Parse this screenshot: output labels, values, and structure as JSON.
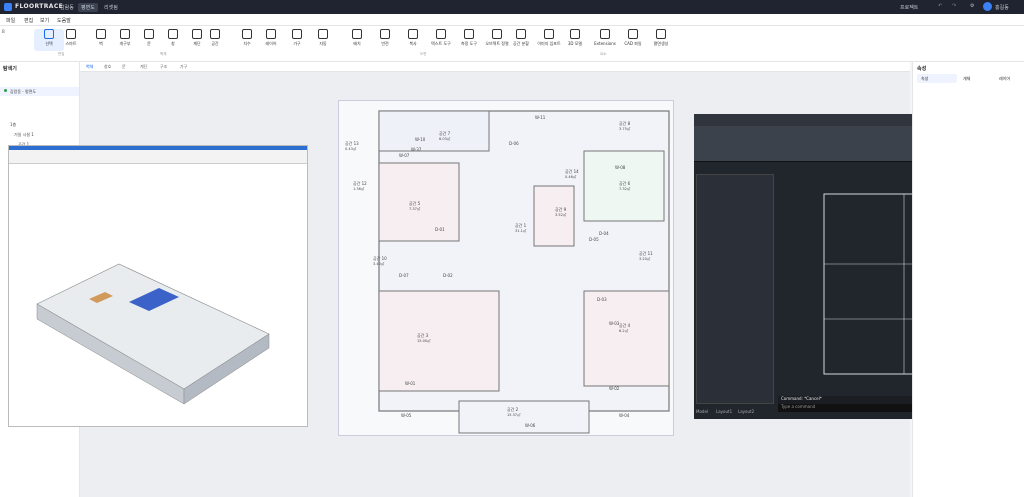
{
  "app": {
    "brand": "FLOORTRACE",
    "project": "감람동",
    "tab": "평면도",
    "file_tag": "리셋됨",
    "right_label": "프로젝트",
    "user": "홍길동"
  },
  "menu": [
    "파일",
    "편집",
    "보기",
    "도움말"
  ],
  "toolbar": {
    "tools": [
      "선택",
      "스마트",
      "벽",
      "개구부",
      "문",
      "창",
      "계단",
      "공간",
      "치수",
      "레이어",
      "가구",
      "자동",
      "배치",
      "반전",
      "복사",
      "텍스트 도구",
      "측정 도구",
      "오브젝트 정렬",
      "공간 분할",
      "이미지 임포트",
      "3D 모델",
      "Extensions",
      "CAD 파일",
      "평면생성"
    ],
    "groups": [
      "편집",
      "벽체",
      "도면",
      "요소"
    ]
  },
  "subtabs": [
    "벽체",
    "창호",
    "문",
    "계단",
    "구조",
    "가구"
  ],
  "left_panel": {
    "title": "탐색기",
    "items": [
      "감람동 - 평면도",
      "1층",
      "거실 시설 1",
      "공간 1"
    ]
  },
  "right_panel": {
    "title": "속성",
    "tab1": "속성",
    "tab2": "개체",
    "tab3": "레이어"
  },
  "floorplan": {
    "rooms": [
      {
        "name": "공간 1",
        "area": "31.1㎡"
      },
      {
        "name": "공간 2",
        "area": "15.37㎡"
      },
      {
        "name": "공간 3",
        "area": "15.00㎡"
      },
      {
        "name": "공간 4",
        "area": "6.2㎡"
      },
      {
        "name": "공간 5",
        "area": "7.37㎡"
      },
      {
        "name": "공간 6",
        "area": "7.32㎡"
      },
      {
        "name": "공간 7",
        "area": "6.03㎡"
      },
      {
        "name": "공간 8",
        "area": "3.75㎡"
      },
      {
        "name": "공간 9",
        "area": "3.52㎡"
      },
      {
        "name": "공간 10",
        "area": "3.40㎡"
      },
      {
        "name": "공간 11",
        "area": "3.20㎡"
      },
      {
        "name": "공간 12",
        "area": "1.36㎡"
      },
      {
        "name": "공간 13",
        "area": "0.43㎡"
      },
      {
        "name": "공간 14",
        "area": "0.46㎡"
      }
    ],
    "walls": [
      "W-01",
      "W-02",
      "W-03",
      "W-04",
      "W-05",
      "W-06",
      "W-07",
      "W-08",
      "W-10",
      "W-11",
      "W-37"
    ],
    "doors": [
      "D-01",
      "D-02",
      "D-03",
      "D-04",
      "D-05",
      "D-06",
      "D-07"
    ]
  },
  "cad": {
    "command": "Command: *Cancel*",
    "prompt": "Type a command",
    "tabs": [
      "Model",
      "Layout1",
      "Layout2"
    ]
  }
}
